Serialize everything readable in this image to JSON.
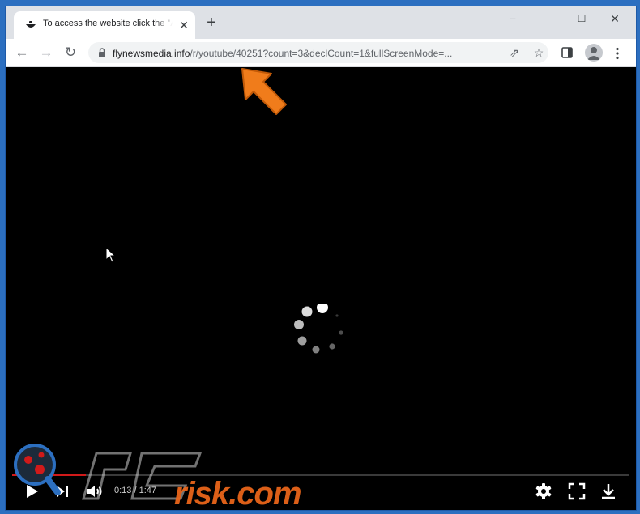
{
  "browser": {
    "tab_title": "To access the website click the \"Allow\" button",
    "tab_close": "✕",
    "new_tab": "+",
    "window_controls": {
      "minimize": "−",
      "maximize": "☐",
      "close": "✕"
    },
    "nav": {
      "back": "←",
      "forward": "→",
      "reload": "↻"
    },
    "url_host": "flynewsmedia.info",
    "url_path": "/r/youtube/40251?count=3&declCount=1&fullScreenMode=...",
    "share": "⇗",
    "star": "☆"
  },
  "player": {
    "time_current": "0:13",
    "time_separator": " / ",
    "time_total": "1:47",
    "progress": 0.12
  },
  "watermark": {
    "text": "risk.com"
  },
  "colors": {
    "accent_arrow": "#f07c1b",
    "progress_red": "#d11a1a",
    "watermark_orange": "#e8651a",
    "desktop_blue": "#2c6fc0"
  },
  "icons": [
    "favicon-icon",
    "close-icon",
    "plus-icon",
    "minimize-icon",
    "maximize-icon",
    "window-close-icon",
    "back-icon",
    "forward-icon",
    "reload-icon",
    "lock-icon",
    "share-icon",
    "star-icon",
    "sidepanel-icon",
    "avatar-icon",
    "menu-icon",
    "arrow-pointer-icon",
    "mouse-cursor-icon",
    "loading-spinner-icon",
    "play-icon",
    "next-icon",
    "volume-icon",
    "settings-icon",
    "fullscreen-icon",
    "download-icon",
    "magnifier-logo-icon"
  ]
}
